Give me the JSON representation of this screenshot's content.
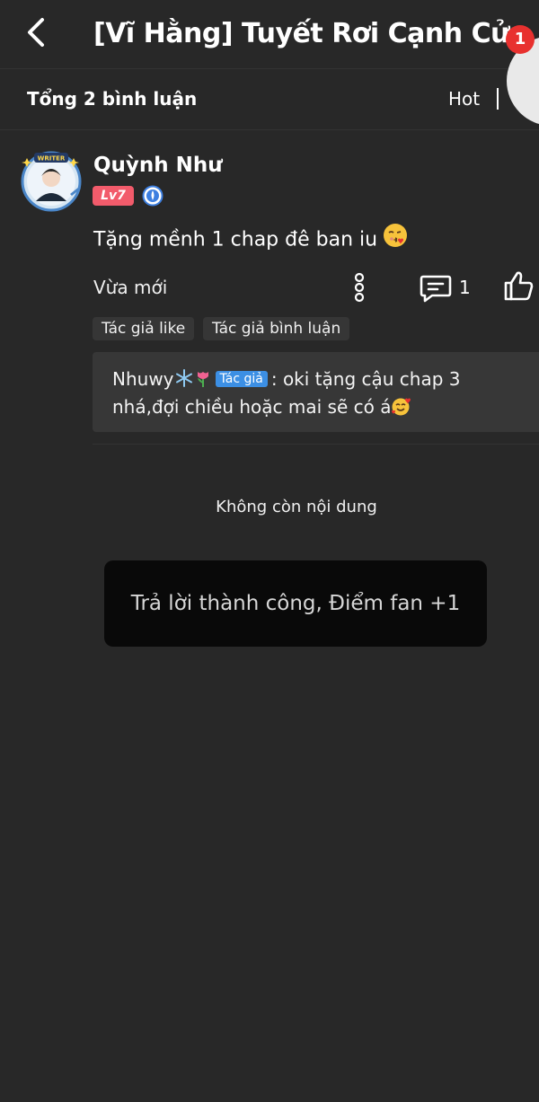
{
  "header": {
    "title": "[Vĩ Hằng] Tuyết Rơi Cạnh Cửa Sổ",
    "notification_count": "1",
    "back_icon": "chevron-left-icon"
  },
  "comments_bar": {
    "total_label": "Tổng 2 bình luận",
    "sort_label": "Hot"
  },
  "comment": {
    "username": "Quỳnh Như",
    "avatar_badge_text": "WRITER",
    "level": "Lv7",
    "text": "Tặng mềnh 1 chap đê ban iu",
    "time": "Vừa mới",
    "reply_count": "1",
    "tags": [
      "Tác giả like",
      "Tác giả bình luận"
    ],
    "reply": {
      "author": "Nhuwy",
      "author_badge": "Tác giả",
      "text": ": oki tặng cậu chap 3 nhá,đợi chiều hoặc mai sẽ có á"
    }
  },
  "end_of_content": "Không còn nội dung",
  "toast": "Trả lời thành công, Điểm fan +1",
  "colors": {
    "background": "#282828",
    "level_badge": "#f25b6b",
    "author_badge": "#3c8fe4",
    "notification": "#e8312f",
    "toast_bg": "#090909"
  }
}
